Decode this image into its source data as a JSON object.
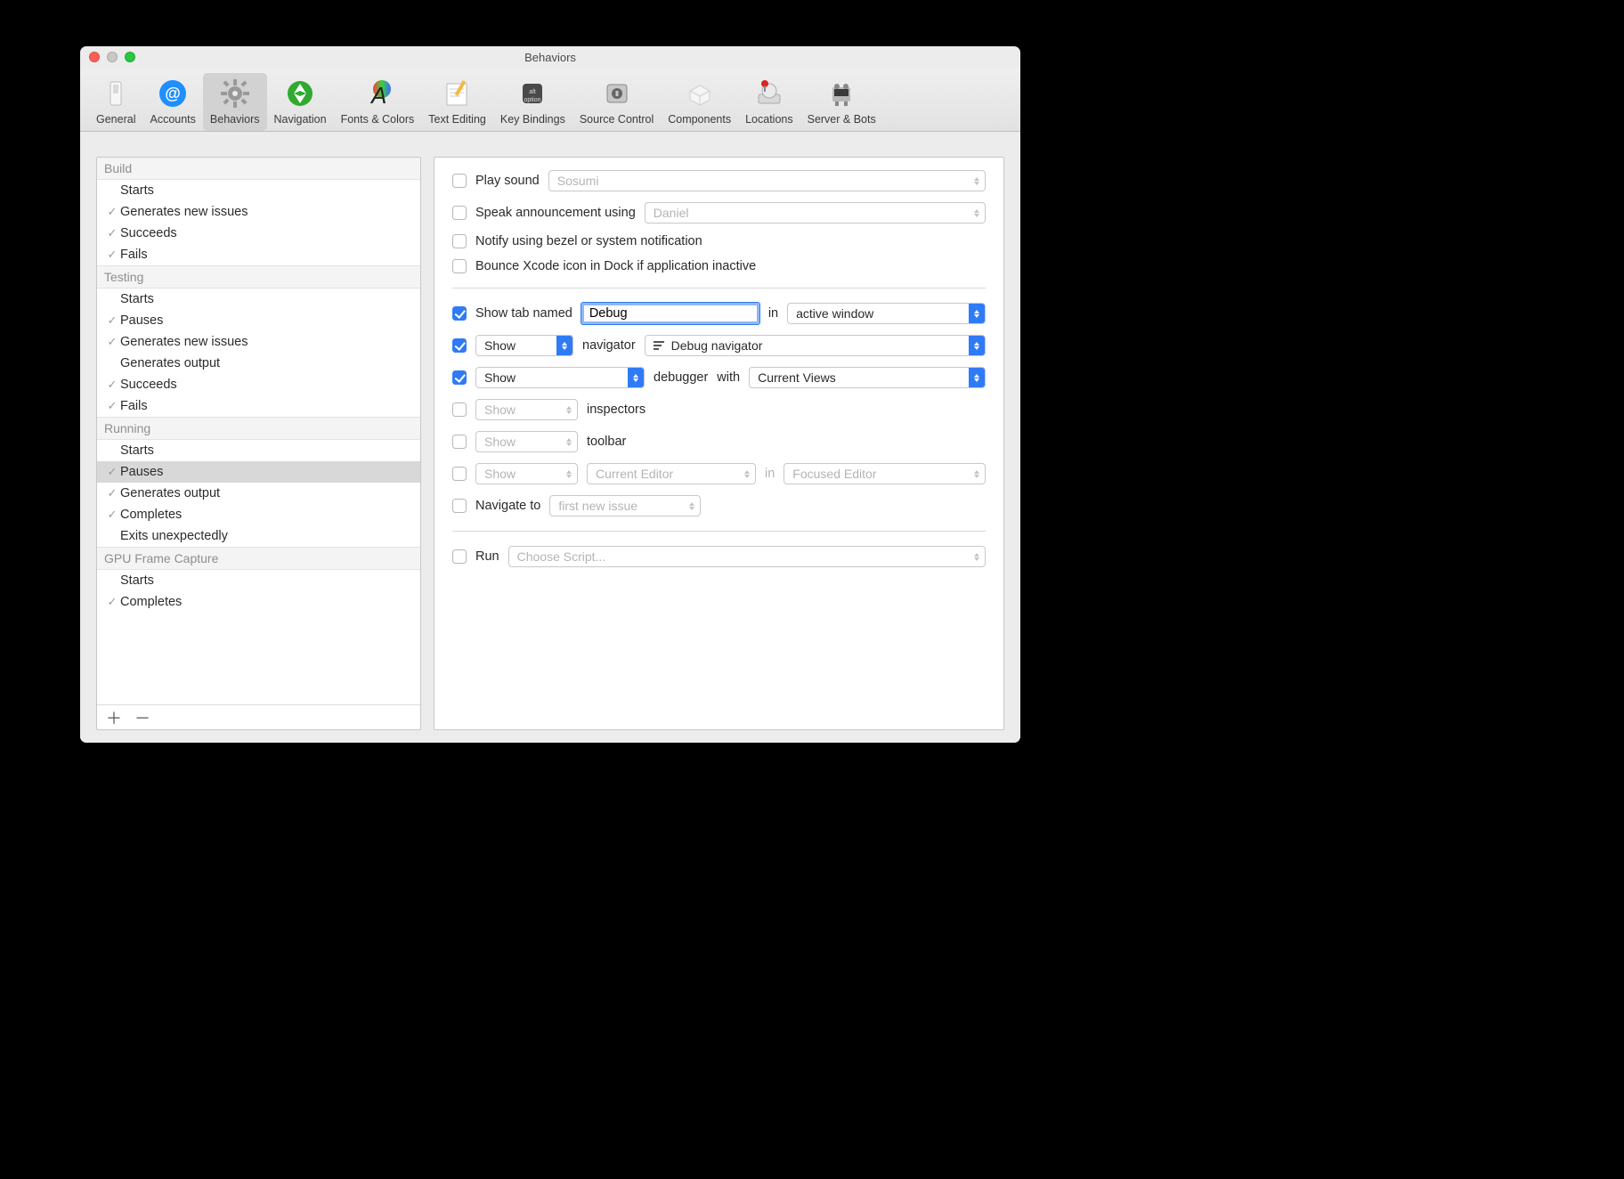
{
  "window": {
    "title": "Behaviors"
  },
  "toolbar": {
    "items": [
      {
        "id": "general",
        "label": "General"
      },
      {
        "id": "accounts",
        "label": "Accounts"
      },
      {
        "id": "behaviors",
        "label": "Behaviors",
        "selected": true
      },
      {
        "id": "navigation",
        "label": "Navigation"
      },
      {
        "id": "fonts",
        "label": "Fonts & Colors"
      },
      {
        "id": "textedit",
        "label": "Text Editing"
      },
      {
        "id": "keybind",
        "label": "Key Bindings"
      },
      {
        "id": "source",
        "label": "Source Control"
      },
      {
        "id": "components",
        "label": "Components"
      },
      {
        "id": "locations",
        "label": "Locations"
      },
      {
        "id": "server",
        "label": "Server & Bots"
      }
    ]
  },
  "sidebar": {
    "groups": [
      {
        "label": "Build",
        "items": [
          {
            "label": "Starts",
            "check": false
          },
          {
            "label": "Generates new issues",
            "check": true
          },
          {
            "label": "Succeeds",
            "check": true
          },
          {
            "label": "Fails",
            "check": true
          }
        ]
      },
      {
        "label": "Testing",
        "items": [
          {
            "label": "Starts",
            "check": false
          },
          {
            "label": "Pauses",
            "check": true
          },
          {
            "label": "Generates new issues",
            "check": true
          },
          {
            "label": "Generates output",
            "check": false
          },
          {
            "label": "Succeeds",
            "check": true
          },
          {
            "label": "Fails",
            "check": true
          }
        ]
      },
      {
        "label": "Running",
        "items": [
          {
            "label": "Starts",
            "check": false
          },
          {
            "label": "Pauses",
            "check": true,
            "selected": true
          },
          {
            "label": "Generates output",
            "check": true
          },
          {
            "label": "Completes",
            "check": true
          },
          {
            "label": "Exits unexpectedly",
            "check": false
          }
        ]
      },
      {
        "label": "GPU Frame Capture",
        "items": [
          {
            "label": "Starts",
            "check": false
          },
          {
            "label": "Completes",
            "check": true
          }
        ]
      }
    ]
  },
  "detail": {
    "playSound": {
      "label": "Play sound",
      "value": "Sosumi",
      "checked": false
    },
    "speak": {
      "label": "Speak announcement using",
      "value": "Daniel",
      "checked": false
    },
    "notify": {
      "label": "Notify using bezel or system notification",
      "checked": false
    },
    "bounce": {
      "label": "Bounce Xcode icon in Dock if application inactive",
      "checked": false
    },
    "showTab": {
      "label": "Show tab named",
      "value": "Debug",
      "mid": "in",
      "scope": "active window",
      "checked": true
    },
    "showNav": {
      "action": "Show",
      "label": "navigator",
      "value": "Debug navigator",
      "checked": true
    },
    "showDbg": {
      "action": "Show",
      "label": "debugger",
      "with": "with",
      "value": "Current Views",
      "checked": true
    },
    "insp": {
      "action": "Show",
      "label": "inspectors",
      "checked": false
    },
    "tb": {
      "action": "Show",
      "label": "toolbar",
      "checked": false
    },
    "editor": {
      "action": "Show",
      "value": "Current Editor",
      "mid": "in",
      "scope": "Focused Editor",
      "checked": false
    },
    "nav": {
      "label": "Navigate to",
      "value": "first new issue",
      "checked": false
    },
    "run": {
      "label": "Run",
      "value": "Choose Script...",
      "checked": false
    }
  }
}
